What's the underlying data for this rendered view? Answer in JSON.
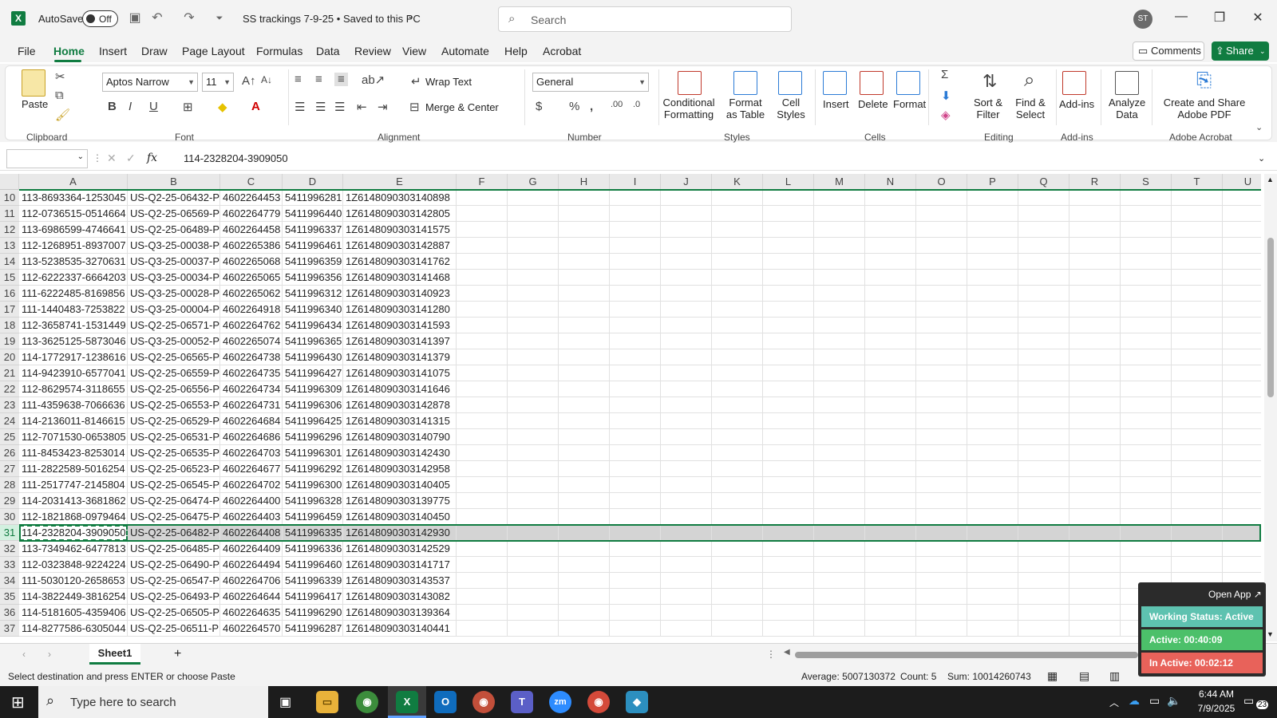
{
  "title_bar": {
    "app_logo": "excel-logo",
    "autosave_label": "AutoSave",
    "autosave_state": "Off",
    "doc_title": "SS trackings 7-9-25 • Saved to this PC",
    "search_placeholder": "Search",
    "avatar_initials": "ST"
  },
  "menu": {
    "tabs": [
      "File",
      "Home",
      "Insert",
      "Draw",
      "Page Layout",
      "Formulas",
      "Data",
      "Review",
      "View",
      "Automate",
      "Help",
      "Acrobat"
    ],
    "active_tab": "Home",
    "comments": "Comments",
    "share": "Share"
  },
  "ribbon": {
    "clipboard": {
      "paste": "Paste",
      "label": "Clipboard"
    },
    "font": {
      "name": "Aptos Narrow",
      "size": "11",
      "bold": "B",
      "italic": "I",
      "underline": "U",
      "label": "Font"
    },
    "alignment": {
      "wrap_text": "Wrap Text",
      "merge_center": "Merge & Center",
      "label": "Alignment"
    },
    "number": {
      "format": "General",
      "label": "Number"
    },
    "styles": {
      "conditional": "Conditional Formatting",
      "format_table": "Format as Table",
      "cell_styles": "Cell Styles",
      "label": "Styles"
    },
    "cells": {
      "insert": "Insert",
      "delete": "Delete",
      "format": "Format",
      "label": "Cells"
    },
    "editing": {
      "sort_filter": "Sort & Filter",
      "find_select": "Find & Select",
      "label": "Editing"
    },
    "addins": {
      "addins": "Add-ins",
      "label": "Add-ins"
    },
    "analyze": {
      "analyze_data": "Analyze Data"
    },
    "acrobat": {
      "create_share": "Create and Share Adobe PDF",
      "label": "Adobe Acrobat"
    }
  },
  "formula_bar": {
    "name_box": "",
    "fx": "fx",
    "content": "114-2328204-3909050"
  },
  "columns": [
    "A",
    "B",
    "C",
    "D",
    "E",
    "F",
    "G",
    "H",
    "I",
    "J",
    "K",
    "L",
    "M",
    "N",
    "O",
    "P",
    "Q",
    "R",
    "S",
    "T",
    "U"
  ],
  "rows": [
    {
      "n": "10",
      "a": "113-8693364-1253045",
      "b": "US-Q2-25-06432-P",
      "c": "4602264453",
      "d": "5411996281",
      "e": "1Z6148090303140898"
    },
    {
      "n": "11",
      "a": "112-0736515-0514664",
      "b": "US-Q2-25-06569-P",
      "c": "4602264779",
      "d": "5411996440",
      "e": "1Z6148090303142805"
    },
    {
      "n": "12",
      "a": "113-6986599-4746641",
      "b": "US-Q2-25-06489-P",
      "c": "4602264458",
      "d": "5411996337",
      "e": "1Z6148090303141575"
    },
    {
      "n": "13",
      "a": "112-1268951-8937007",
      "b": "US-Q3-25-00038-P",
      "c": "4602265386",
      "d": "5411996461",
      "e": "1Z6148090303142887"
    },
    {
      "n": "14",
      "a": "113-5238535-3270631",
      "b": "US-Q3-25-00037-P",
      "c": "4602265068",
      "d": "5411996359",
      "e": "1Z6148090303141762"
    },
    {
      "n": "15",
      "a": "112-6222337-6664203",
      "b": "US-Q3-25-00034-P",
      "c": "4602265065",
      "d": "5411996356",
      "e": "1Z6148090303141468"
    },
    {
      "n": "16",
      "a": "111-6222485-8169856",
      "b": "US-Q3-25-00028-P",
      "c": "4602265062",
      "d": "5411996312",
      "e": "1Z6148090303140923"
    },
    {
      "n": "17",
      "a": "111-1440483-7253822",
      "b": "US-Q3-25-00004-P",
      "c": "4602264918",
      "d": "5411996340",
      "e": "1Z6148090303141280"
    },
    {
      "n": "18",
      "a": "112-3658741-1531449",
      "b": "US-Q2-25-06571-P",
      "c": "4602264762",
      "d": "5411996434",
      "e": "1Z6148090303141593"
    },
    {
      "n": "19",
      "a": "113-3625125-5873046",
      "b": "US-Q3-25-00052-P",
      "c": "4602265074",
      "d": "5411996365",
      "e": "1Z6148090303141397"
    },
    {
      "n": "20",
      "a": "114-1772917-1238616",
      "b": "US-Q2-25-06565-P",
      "c": "4602264738",
      "d": "5411996430",
      "e": "1Z6148090303141379"
    },
    {
      "n": "21",
      "a": "114-9423910-6577041",
      "b": "US-Q2-25-06559-P",
      "c": "4602264735",
      "d": "5411996427",
      "e": "1Z6148090303141075"
    },
    {
      "n": "22",
      "a": "112-8629574-3118655",
      "b": "US-Q2-25-06556-P",
      "c": "4602264734",
      "d": "5411996309",
      "e": "1Z6148090303141646"
    },
    {
      "n": "23",
      "a": "111-4359638-7066636",
      "b": "US-Q2-25-06553-P",
      "c": "4602264731",
      "d": "5411996306",
      "e": "1Z6148090303142878"
    },
    {
      "n": "24",
      "a": "114-2136011-8146615",
      "b": "US-Q2-25-06529-P",
      "c": "4602264684",
      "d": "5411996425",
      "e": "1Z6148090303141315"
    },
    {
      "n": "25",
      "a": "112-7071530-0653805",
      "b": "US-Q2-25-06531-P",
      "c": "4602264686",
      "d": "5411996296",
      "e": "1Z6148090303140790"
    },
    {
      "n": "26",
      "a": "111-8453423-8253014",
      "b": "US-Q2-25-06535-P",
      "c": "4602264703",
      "d": "5411996301",
      "e": "1Z6148090303142430"
    },
    {
      "n": "27",
      "a": "111-2822589-5016254",
      "b": "US-Q2-25-06523-P",
      "c": "4602264677",
      "d": "5411996292",
      "e": "1Z6148090303142958"
    },
    {
      "n": "28",
      "a": "111-2517747-2145804",
      "b": "US-Q2-25-06545-P",
      "c": "4602264702",
      "d": "5411996300",
      "e": "1Z6148090303140405"
    },
    {
      "n": "29",
      "a": "114-2031413-3681862",
      "b": "US-Q2-25-06474-P",
      "c": "4602264400",
      "d": "5411996328",
      "e": "1Z6148090303139775"
    },
    {
      "n": "30",
      "a": "112-1821868-0979464",
      "b": "US-Q2-25-06475-P",
      "c": "4602264403",
      "d": "5411996459",
      "e": "1Z6148090303140450"
    },
    {
      "n": "31",
      "a": "114-2328204-3909050",
      "b": "US-Q2-25-06482-P",
      "c": "4602264408",
      "d": "5411996335",
      "e": "1Z6148090303142930",
      "selected": true
    },
    {
      "n": "32",
      "a": "113-7349462-6477813",
      "b": "US-Q2-25-06485-P",
      "c": "4602264409",
      "d": "5411996336",
      "e": "1Z6148090303142529"
    },
    {
      "n": "33",
      "a": "112-0323848-9224224",
      "b": "US-Q2-25-06490-P",
      "c": "4602264494",
      "d": "5411996460",
      "e": "1Z6148090303141717"
    },
    {
      "n": "34",
      "a": "111-5030120-2658653",
      "b": "US-Q2-25-06547-P",
      "c": "4602264706",
      "d": "5411996339",
      "e": "1Z6148090303143537"
    },
    {
      "n": "35",
      "a": "114-3822449-3816254",
      "b": "US-Q2-25-06493-P",
      "c": "4602264644",
      "d": "5411996417",
      "e": "1Z6148090303143082"
    },
    {
      "n": "36",
      "a": "114-5181605-4359406",
      "b": "US-Q2-25-06505-P",
      "c": "4602264635",
      "d": "5411996290",
      "e": "1Z6148090303139364"
    },
    {
      "n": "37",
      "a": "114-8277586-6305044",
      "b": "US-Q2-25-06511-P",
      "c": "4602264570",
      "d": "5411996287",
      "e": "1Z6148090303140441"
    }
  ],
  "sheet_tabs": {
    "active": "Sheet1",
    "add": "+"
  },
  "status_bar": {
    "message": "Select destination and press ENTER or choose Paste",
    "average": "Average: 5007130372",
    "count": "Count: 5",
    "sum": "Sum: 10014260743"
  },
  "widget": {
    "open_app": "Open App ↗",
    "working_status": "Working Status: Active",
    "active": "Active: 00:40:09",
    "inactive": "In Active: 00:02:12",
    "colors": {
      "status": "#5ec2b0",
      "active": "#4cc06a",
      "inactive": "#e8625a"
    }
  },
  "taskbar": {
    "search_placeholder": "Type here to search",
    "time": "6:44 AM",
    "date": "7/9/2025",
    "notifications": "23"
  },
  "accent": "#107c41"
}
